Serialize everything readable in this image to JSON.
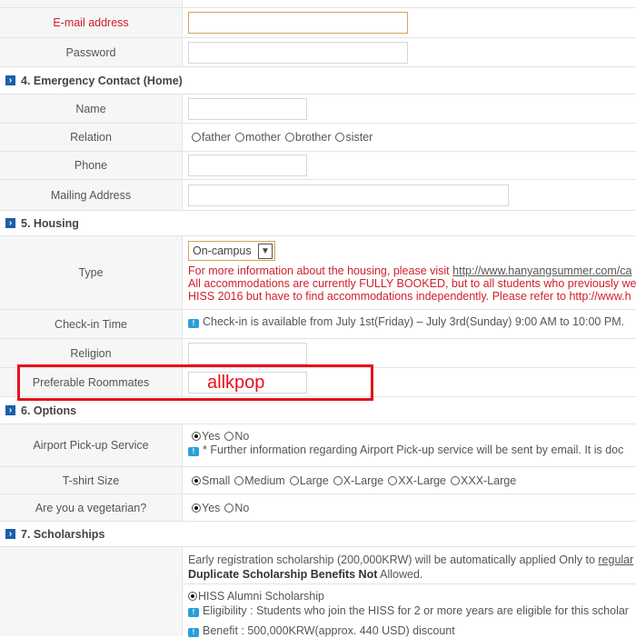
{
  "contact": {
    "email_label": "E-mail address",
    "password_label": "Password"
  },
  "section4": {
    "title": "4. Emergency Contact (Home)",
    "name_label": "Name",
    "relation_label": "Relation",
    "relation_options": [
      "father",
      "mother",
      "brother",
      "sister"
    ],
    "phone_label": "Phone",
    "mailing_label": "Mailing Address"
  },
  "section5": {
    "title": "5. Housing",
    "type_label": "Type",
    "type_value": "On-campus",
    "type_info_1": "For more information about the housing, please visit ",
    "type_link": "http://www.hanyangsummer.com/ca",
    "type_info_2": "All accommodations are currently FULLY BOOKED, but to all students who previously were",
    "type_info_3": "HISS 2016 but have to find accommodations independently. Please refer to http://www.h",
    "checkin_label": "Check-in Time",
    "checkin_info": "Check-in is available from July 1st(Friday) – July 3rd(Sunday) 9:00 AM to 10:00 PM.",
    "religion_label": "Religion",
    "roommates_label": "Preferable Roommates",
    "roommates_value": "allkpop"
  },
  "section6": {
    "title": "6. Options",
    "airport_label": "Airport Pick-up Service",
    "airport_options": [
      "Yes",
      "No"
    ],
    "airport_info": "* Further information regarding Airport Pick-up service will be sent by email. It is doc",
    "tshirt_label": "T-shirt Size",
    "tshirt_options": [
      "Small",
      "Medium",
      "Large",
      "X-Large",
      "XX-Large",
      "XXX-Large"
    ],
    "veg_label": "Are you a vegetarian?",
    "veg_options": [
      "Yes",
      "No"
    ]
  },
  "section7": {
    "title": "7. Scholarships",
    "early_text": "Early registration scholarship (200,000KRW) will be automatically applied Only to ",
    "early_link": "regular",
    "dup_bold": "Duplicate Scholarship Benefits Not",
    "dup_rest": " Allowed.",
    "alumni_label": "HISS Alumni Scholarship",
    "eligibility": "Eligibility : Students who join the HISS for 2 or more years are eligible for this scholar",
    "benefit": "Benefit : 500,000KRW(approx. 440 USD) discount"
  },
  "colors": {
    "accent": "#1d5ea8",
    "warning_text": "#d0202a",
    "highlight_box": "#e8101c"
  }
}
